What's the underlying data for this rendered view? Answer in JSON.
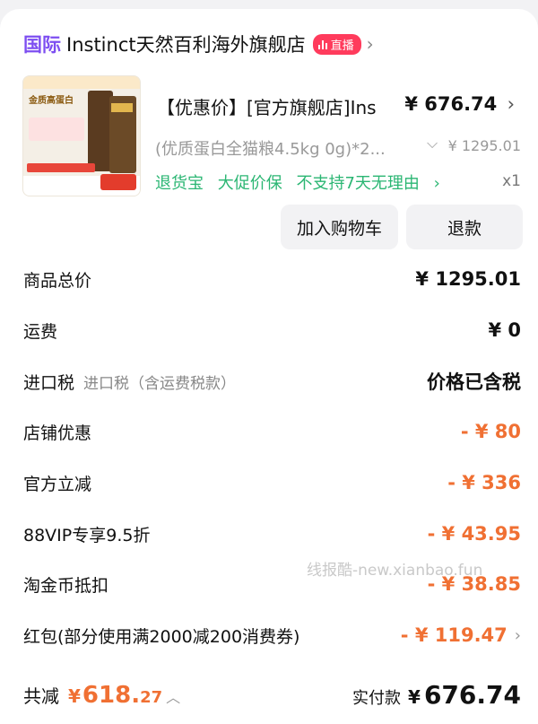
{
  "shop": {
    "badge": "国际",
    "name": "Instinct天然百利海外旗舰店",
    "live_label": "直播"
  },
  "product": {
    "title": "【优惠价】[官方旗舰店]Ins",
    "price": "¥ 676.74",
    "spec": "(优质蛋白全猫粮4.5kg 0g)*2...",
    "original_price": "¥ 1295.01",
    "services": [
      "退货宝",
      "大促价保",
      "不支持7天无理由"
    ],
    "quantity": "x1",
    "thumb_title": "金质高蛋白"
  },
  "actions": {
    "add_to_cart": "加入购物车",
    "refund": "退款"
  },
  "summary": [
    {
      "label": "商品总价",
      "sub": "",
      "value": "¥ 1295.01",
      "highlight": false
    },
    {
      "label": "运费",
      "sub": "",
      "value": "¥ 0",
      "highlight": false
    },
    {
      "label": "进口税",
      "sub": "进口税（含运费税款）",
      "value": "价格已含税",
      "highlight": false
    },
    {
      "label": "店铺优惠",
      "sub": "",
      "value": "- ¥ 80",
      "highlight": true
    },
    {
      "label": "官方立减",
      "sub": "",
      "value": "- ¥ 336",
      "highlight": true
    },
    {
      "label": "88VIP专享9.5折",
      "sub": "",
      "value": "- ¥ 43.95",
      "highlight": true
    },
    {
      "label": "淘金币抵扣",
      "sub": "",
      "value": "- ¥ 38.85",
      "highlight": true
    },
    {
      "label": "红包(部分使用满2000减200消费券)",
      "sub": "",
      "value": "- ¥ 119.47",
      "highlight": true
    }
  ],
  "watermark": "线报酷-new.xianbao.fun",
  "footer": {
    "saved_label": "共减",
    "saved_currency": "¥",
    "saved_int": "618.",
    "saved_dec": "27",
    "paid_label": "实付款",
    "paid_currency": "¥",
    "paid_amount": "676.74"
  },
  "colors": {
    "accent_orange": "#f07033",
    "service_green": "#2bb673",
    "live_red": "#ff3b5c",
    "intl_purple": "#7d4ef1"
  }
}
